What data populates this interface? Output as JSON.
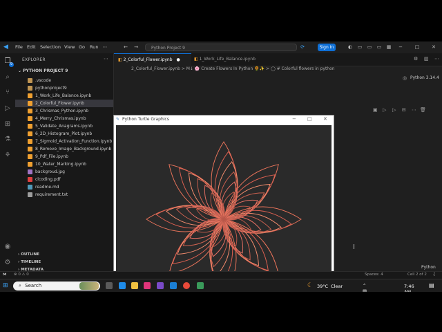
{
  "window": {
    "menu": [
      "File",
      "Edit",
      "Selection",
      "View",
      "Go",
      "Run"
    ],
    "command_center": "Python Project 9",
    "sign_in": "Sign In",
    "controls": [
      "−",
      "□",
      "✕"
    ]
  },
  "activity_badge": "9",
  "explorer": {
    "title": "EXPLORER",
    "project": "PYTHON PROJECT 9",
    "items": [
      {
        "label": ".vscode",
        "type": "folder"
      },
      {
        "label": "pythonproject9",
        "type": "folder"
      },
      {
        "label": "1_Work_Life_Balance.ipynb",
        "type": "nb"
      },
      {
        "label": "2_Colorful_Flower.ipynb",
        "type": "nb"
      },
      {
        "label": "3_Chrismas_Python.ipynb",
        "type": "nb"
      },
      {
        "label": "4_Merry_Chrismas.ipynb",
        "type": "nb"
      },
      {
        "label": "5_Validate_Anagrams.ipynb",
        "type": "nb"
      },
      {
        "label": "6_2D_Histogram_Plot.ipynb",
        "type": "nb"
      },
      {
        "label": "7_Sigmoid_Activation_Function.ipynb",
        "type": "nb"
      },
      {
        "label": "8_Remove_Image_Background.ipynb",
        "type": "nb"
      },
      {
        "label": "9_Pdf_File.ipynb",
        "type": "nb"
      },
      {
        "label": "10_Water_Marking.ipynb",
        "type": "nb"
      },
      {
        "label": "backgroud.jpg",
        "type": "img"
      },
      {
        "label": "clcoding.pdf",
        "type": "pdf"
      },
      {
        "label": "readme.md",
        "type": "md"
      },
      {
        "label": "requirement.txt",
        "type": "txt"
      }
    ],
    "selected_index": 3,
    "sections": [
      "OUTLINE",
      "TIMELINE",
      "METADATA"
    ]
  },
  "tabs": [
    {
      "label": "2_Colorful_Flower.ipynb",
      "active": true,
      "modified": true
    },
    {
      "label": "1_Work_Life_Balance.ipynb",
      "active": false,
      "modified": false
    }
  ],
  "breadcrumb": "2_Colorful_Flower.ipynb > M↓ 🌸 Create Flowers In Python 🌻✨ > ◯ # Colorful flowers in python",
  "kernel": "Python 3.14.4",
  "turtle_window": {
    "title": "Python Turtle Graphics",
    "controls": [
      "−",
      "□",
      "✕"
    ]
  },
  "flower": {
    "petals": 8,
    "layers": 6,
    "colors": [
      "#e8735a",
      "#d95f50",
      "#f08a6c",
      "#c9604f",
      "#e26e62",
      "#b85748"
    ],
    "background": "#2a2a2a"
  },
  "status": {
    "left": "⊗ 0 ⚠ 0",
    "spaces": "Spaces: 4",
    "cell": "Cell 2 of 2",
    "lang": "Python"
  },
  "taskbar": {
    "search": "Search",
    "weather": "39°C",
    "weather_desc": "Clear",
    "time": "7:46 AM"
  },
  "colors": {
    "accent": "#0e6fd6",
    "editor_bg": "#1f1f1f",
    "sidebar_bg": "#181818"
  }
}
